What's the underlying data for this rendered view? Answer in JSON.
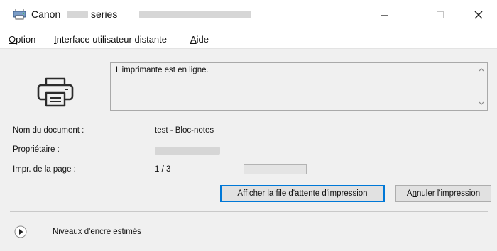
{
  "window": {
    "title_brand": "Canon",
    "title_series": "series",
    "buttons": {
      "minimize": "–",
      "maximize": "□",
      "close": "✕"
    }
  },
  "menu": [
    {
      "accel": "O",
      "rest": "ption"
    },
    {
      "accel": "I",
      "rest": "nterface utilisateur distante"
    },
    {
      "accel": "A",
      "rest": "ide"
    }
  ],
  "status": {
    "message": "L'imprimante est en ligne."
  },
  "details": {
    "document_label": "Nom du document :",
    "document_value": "test - Bloc-notes",
    "owner_label": "Propriétaire :",
    "page_label": "Impr. de la page :",
    "page_value": "1 / 3",
    "progress_fraction": 0.0
  },
  "actions": {
    "queue_label": "Afficher la file d'attente d'impression",
    "cancel_accel": "n",
    "cancel_prefix": "A",
    "cancel_rest": "nuler l'impression"
  },
  "ink": {
    "label": "Niveaux d'encre estimés"
  },
  "icons": {
    "app": "canon-printer-icon",
    "printer": "printer-icon",
    "expand": "expand-arrow-icon"
  },
  "colors": {
    "panel_bg": "#f0f0f0",
    "focus_border": "#0078d7",
    "progress_fill": "#06b025"
  }
}
